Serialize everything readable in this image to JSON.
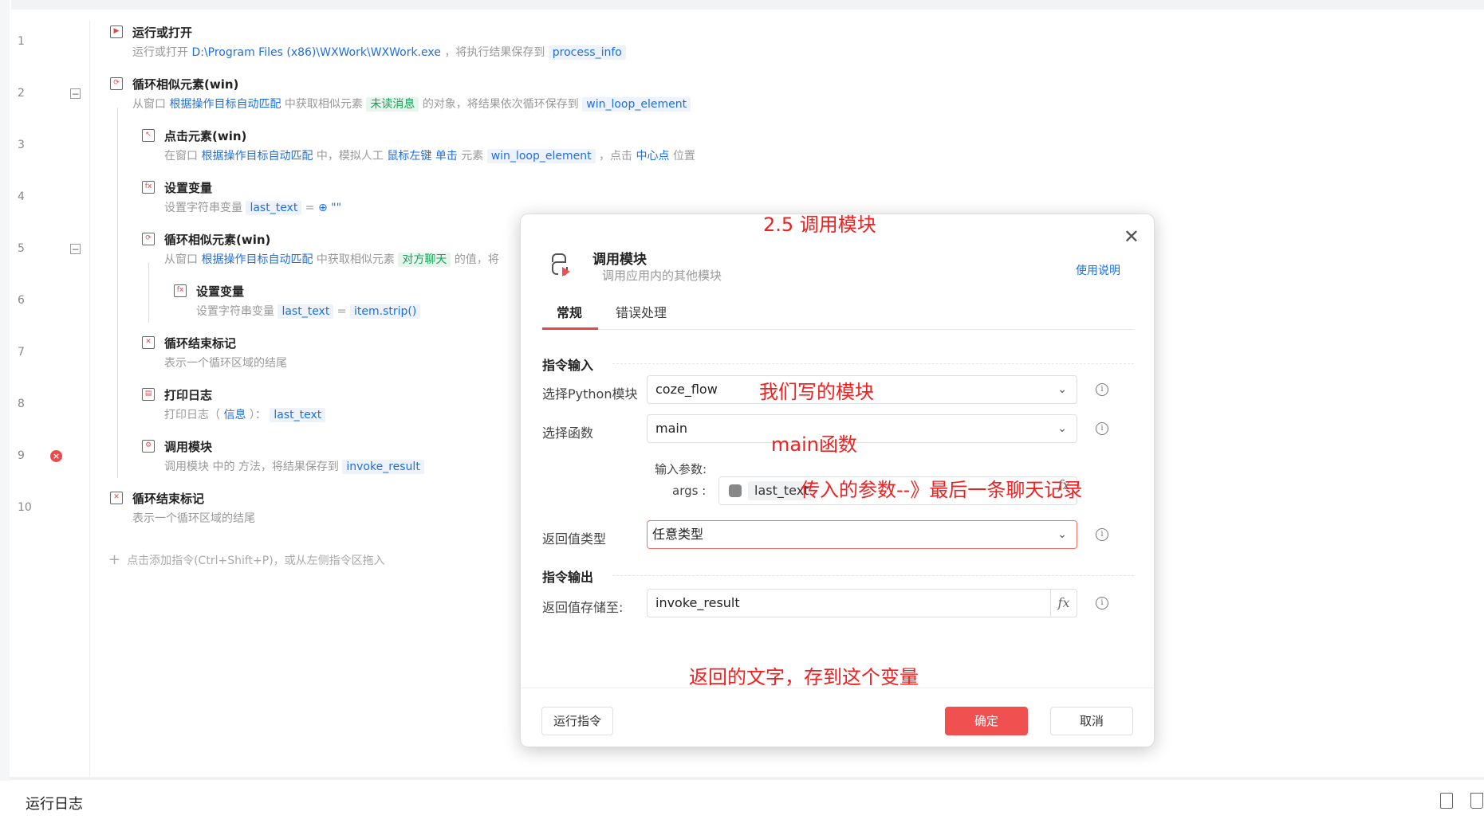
{
  "lines": [
    "1",
    "2",
    "3",
    "4",
    "5",
    "6",
    "7",
    "8",
    "9",
    "10"
  ],
  "steps": {
    "s1": {
      "title": "运行或打开",
      "d1": "运行或打开",
      "path": "D:\\Program Files (x86)\\WXWork\\WXWork.exe",
      "d2": "，将执行结果保存到",
      "var": "process_info"
    },
    "s2": {
      "title": "循环相似元素(win)",
      "d1": "从窗口",
      "link": "根据操作目标自动匹配",
      "d2": "中获取相似元素",
      "tag": "未读消息",
      "d3": "的对象，将结果依次循环保存到",
      "var": "win_loop_element"
    },
    "s3": {
      "title": "点击元素(win)",
      "d1": "在窗口",
      "link": "根据操作目标自动匹配",
      "d2": "中，模拟人工",
      "link2": "鼠标左键",
      "link3": "单击",
      "d3": "元素",
      "var": "win_loop_element",
      "d4": "，点击",
      "link4": "中心点",
      "d5": "位置"
    },
    "s4": {
      "title": "设置变量",
      "d1": "设置字符串变量",
      "var": "last_text",
      "d2": "=",
      "val": "⊕ \"\""
    },
    "s5": {
      "title": "循环相似元素(win)",
      "d1": "从窗口",
      "link": "根据操作目标自动匹配",
      "d2": "中获取相似元素",
      "tag": "对方聊天",
      "d3": "的值，将"
    },
    "s6": {
      "title": "设置变量",
      "d1": "设置字符串变量",
      "var": "last_text",
      "d2": "=",
      "var2": "item.strip()"
    },
    "s7": {
      "title": "循环结束标记",
      "d1": "表示一个循环区域的结尾"
    },
    "s8": {
      "title": "打印日志",
      "d1": "打印日志（",
      "link": "信息",
      "d2": "）：",
      "var": "last_text"
    },
    "s9": {
      "title": "调用模块",
      "d1": "调用模块  中的  方法，将结果保存到",
      "var": "invoke_result"
    },
    "s10": {
      "title": "循环结束标记",
      "d1": "表示一个循环区域的结尾"
    }
  },
  "add_hint": "点击添加指令(Ctrl+Shift+P)，或从左侧指令区拖入",
  "bottom": {
    "label": "运行日志"
  },
  "dialog": {
    "title": "调用模块",
    "subtitle": "调用应用内的其他模块",
    "help": "使用说明",
    "tabs": [
      "常规",
      "错误处理"
    ],
    "section_input": "指令输入",
    "module_label": "选择Python模块",
    "module_value": "coze_flow",
    "func_label": "选择函数",
    "func_value": "main",
    "params_label": "输入参数:",
    "args_label": "args :",
    "args_value": "last_text",
    "return_type_label": "返回值类型",
    "return_type_value": "任意类型",
    "section_output": "指令输出",
    "save_label": "返回值存储至:",
    "save_value": "invoke_result",
    "run_btn": "运行指令",
    "ok_btn": "确定",
    "cancel_btn": "取消"
  },
  "annotations": {
    "a1": "2.5 调用模块",
    "a2": "我们写的模块",
    "a3": "main函数",
    "a4": "传入的参数--》最后一条聊天记录",
    "a5": "返回的文字，存到这个变量"
  },
  "colors": {
    "accent": "#f05050",
    "link": "#1f6fe0",
    "annotation": "#f02020"
  }
}
